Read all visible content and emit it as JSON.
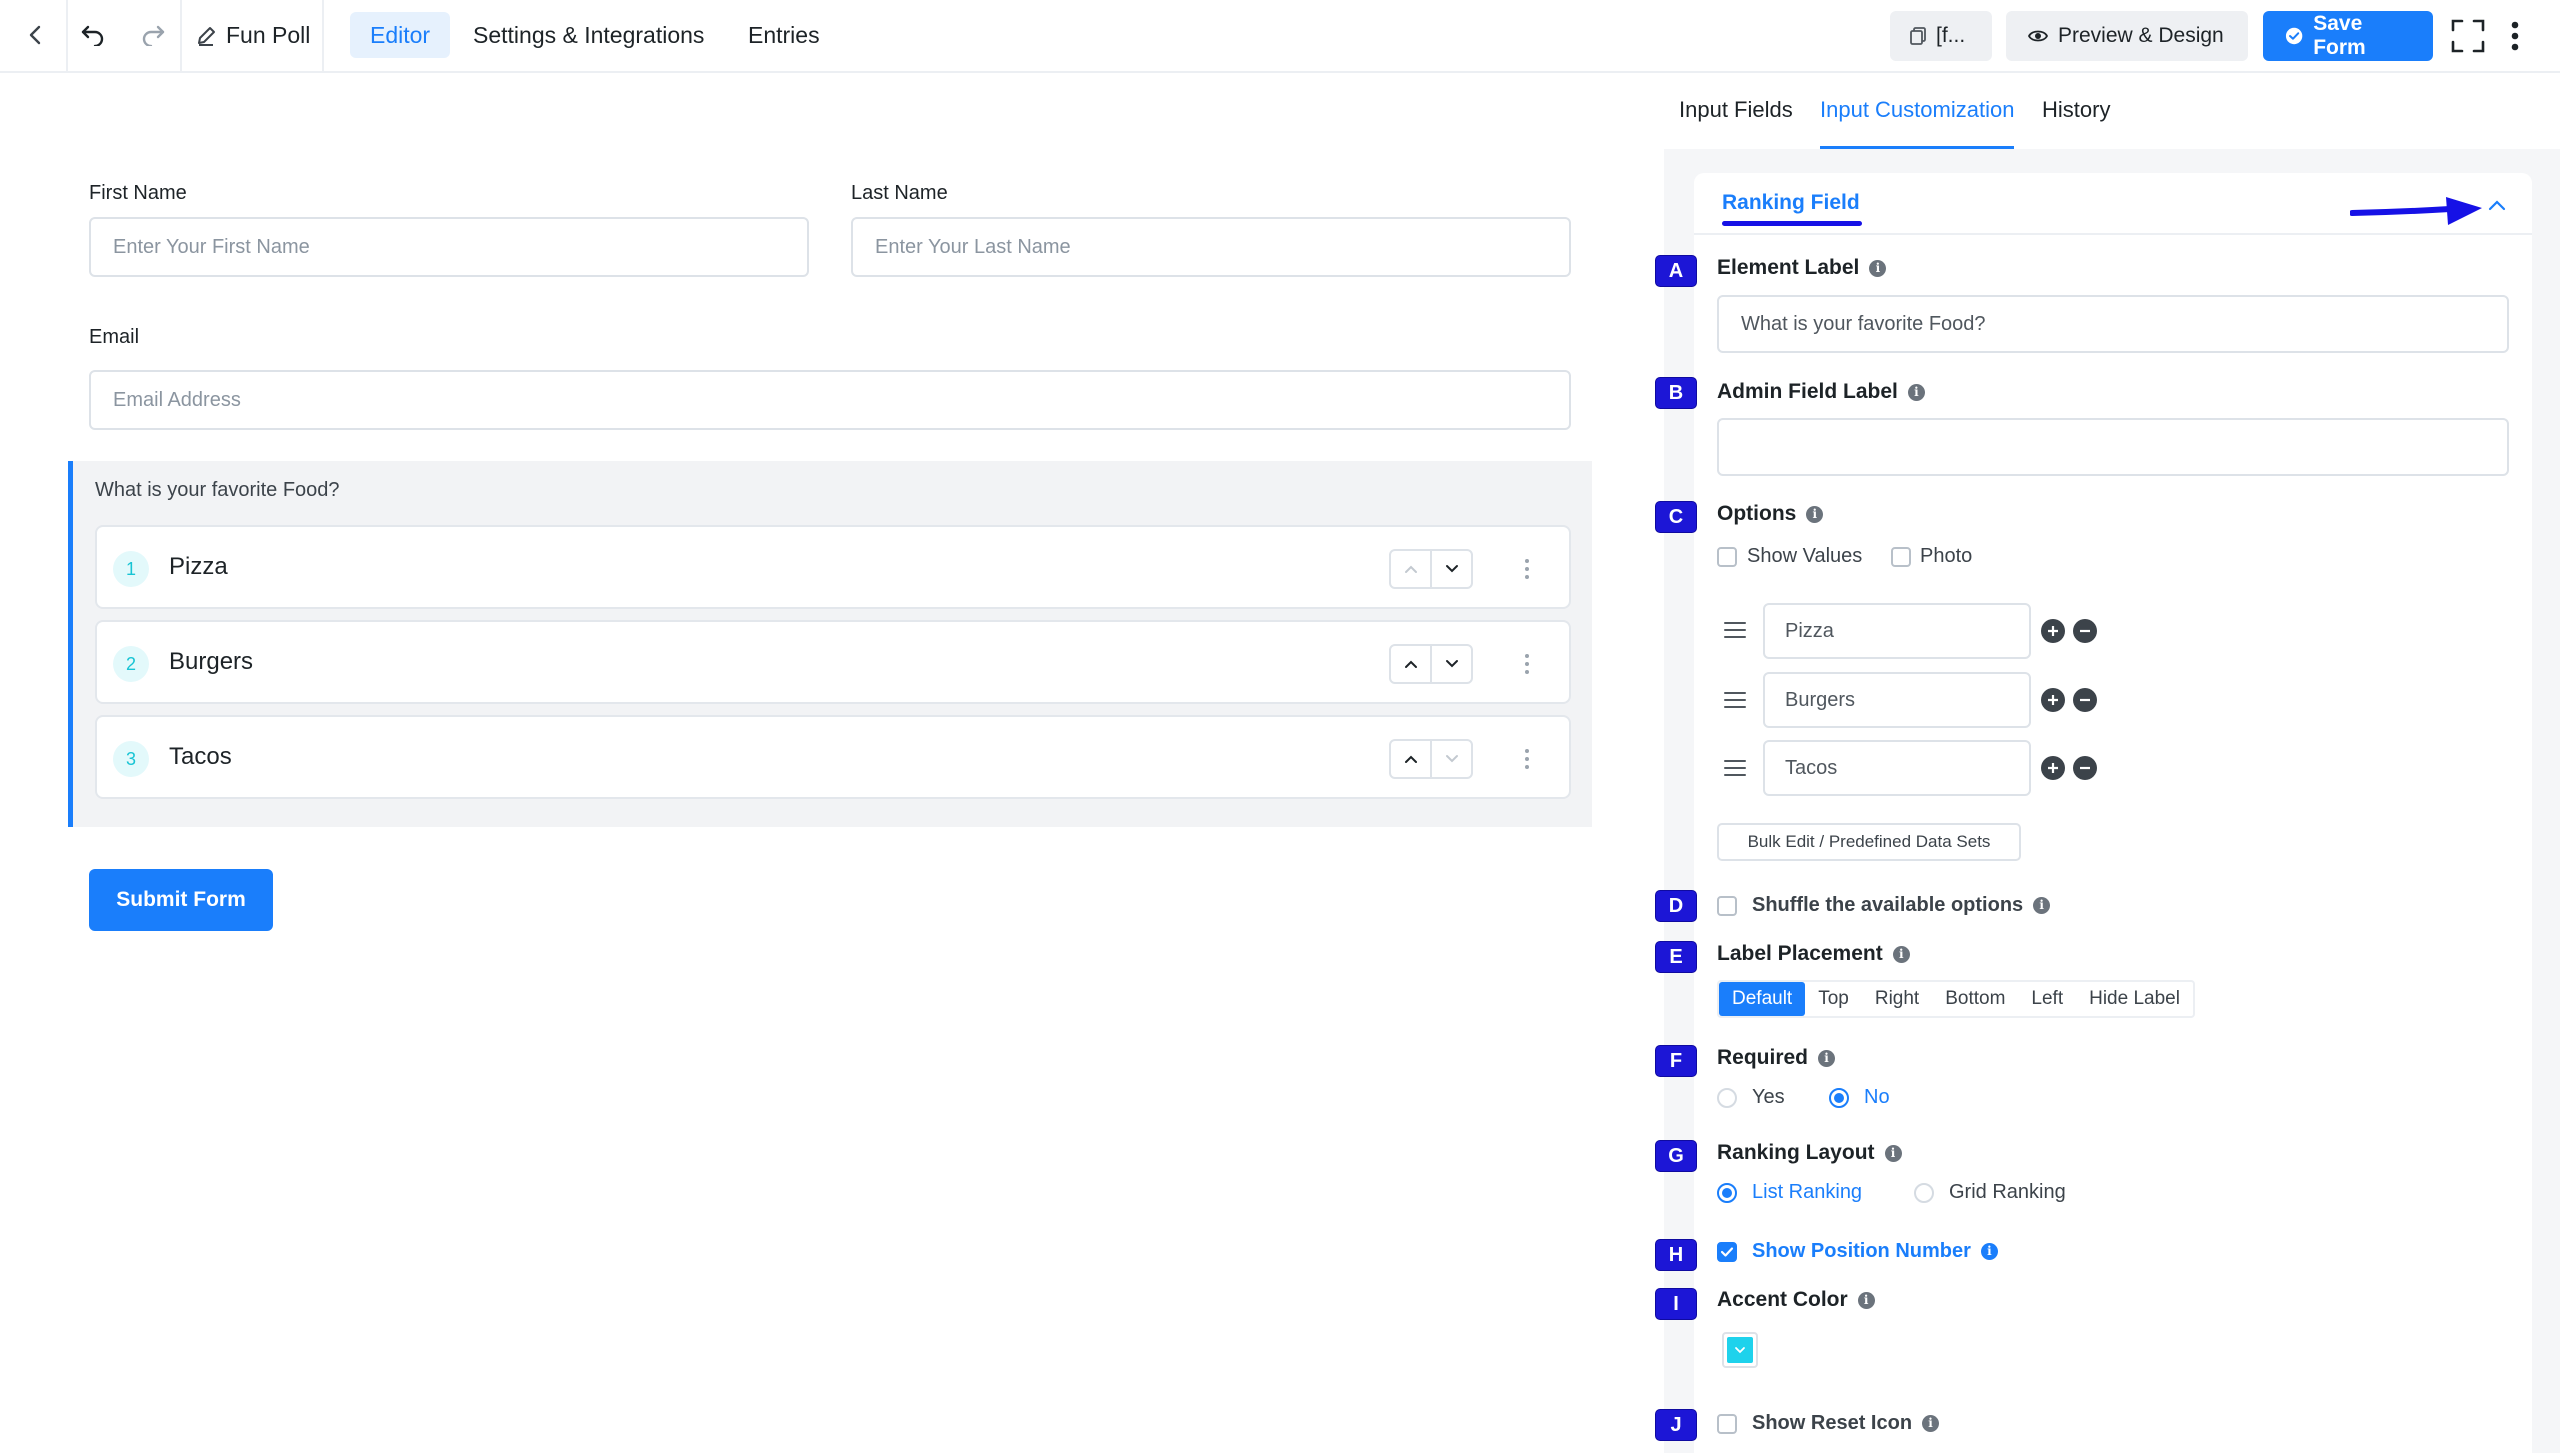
{
  "topbar": {
    "form_title": "Fun Poll",
    "tabs": [
      {
        "label": "Editor",
        "active": true
      },
      {
        "label": "Settings & Integrations",
        "active": false
      },
      {
        "label": "Entries",
        "active": false
      }
    ],
    "shortcode_label": "[f...",
    "preview_label": "Preview & Design",
    "save_label": "Save Form"
  },
  "form": {
    "first_name": {
      "label": "First Name",
      "placeholder": "Enter Your First Name"
    },
    "last_name": {
      "label": "Last Name",
      "placeholder": "Enter Your Last Name"
    },
    "email": {
      "label": "Email",
      "placeholder": "Email Address"
    },
    "ranking": {
      "question": "What is your favorite Food?",
      "items": [
        {
          "number": "1",
          "label": "Pizza"
        },
        {
          "number": "2",
          "label": "Burgers"
        },
        {
          "number": "3",
          "label": "Tacos"
        }
      ]
    },
    "submit_label": "Submit Form"
  },
  "panel": {
    "tabs": [
      {
        "label": "Input Fields",
        "active": false
      },
      {
        "label": "Input Customization",
        "active": true
      },
      {
        "label": "History",
        "active": false
      }
    ],
    "card_title": "Ranking Field",
    "element_label": {
      "label": "Element Label",
      "value": "What is your favorite Food?"
    },
    "admin_field_label": {
      "label": "Admin Field Label",
      "value": ""
    },
    "options": {
      "label": "Options",
      "show_values": "Show Values",
      "photo": "Photo",
      "items": [
        "Pizza",
        "Burgers",
        "Tacos"
      ],
      "bulk_edit": "Bulk Edit / Predefined Data Sets"
    },
    "shuffle": "Shuffle the available options",
    "label_placement": {
      "label": "Label Placement",
      "options": [
        "Default",
        "Top",
        "Right",
        "Bottom",
        "Left",
        "Hide Label"
      ],
      "selected": "Default"
    },
    "required": {
      "label": "Required",
      "yes": "Yes",
      "no": "No",
      "selected": "No"
    },
    "ranking_layout": {
      "label": "Ranking Layout",
      "list": "List Ranking",
      "grid": "Grid Ranking",
      "selected": "List Ranking"
    },
    "show_position_number": {
      "label": "Show Position Number",
      "checked": true
    },
    "accent_color": {
      "label": "Accent Color",
      "value": "#1ed2ec"
    },
    "show_reset_icon": {
      "label": "Show Reset Icon",
      "checked": false
    }
  },
  "annotations": [
    "A",
    "B",
    "C",
    "D",
    "E",
    "F",
    "G",
    "H",
    "I",
    "J"
  ],
  "colors": {
    "primary": "#1a7efb",
    "annotation": "#1c16d6",
    "accent": "#1ed2ec"
  }
}
